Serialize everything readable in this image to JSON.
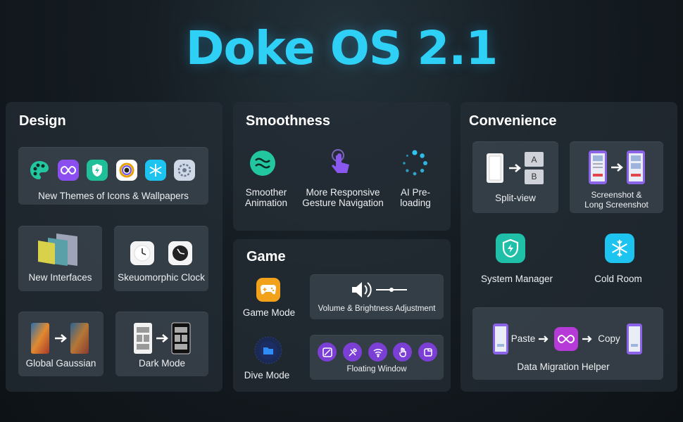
{
  "title": "Doke OS 2.1",
  "colors": {
    "accent": "#2fd0f6",
    "purple": "#7b3fd6",
    "teal": "#1fbfa8"
  },
  "design": {
    "title": "Design",
    "themes": "New Themes of Icons & Wallpapers",
    "interfaces": "New Interfaces",
    "clock": "Skeuomorphic Clock",
    "gaussian": "Global Gaussian",
    "dark": "Dark Mode"
  },
  "smoothness": {
    "title": "Smoothness",
    "anim_1": "Smoother",
    "anim_2": "Animation",
    "gesture_1": "More Responsive",
    "gesture_2": "Gesture Navigation",
    "ai_1": "AI Pre-",
    "ai_2": "loading"
  },
  "game": {
    "title": "Game",
    "game_mode": "Game Mode",
    "volume": "Volume & Brightness Adjustment",
    "dive": "Dive Mode",
    "floating": "Floating Window"
  },
  "convenience": {
    "title": "Convenience",
    "split": "Split-view",
    "split_a": "A",
    "split_b": "B",
    "shot_1": "Screenshot &",
    "shot_2": "Long Screenshot",
    "sysman": "System Manager",
    "cold": "Cold Room",
    "paste": "Paste",
    "copy": "Copy",
    "migration": "Data Migration Helper"
  }
}
